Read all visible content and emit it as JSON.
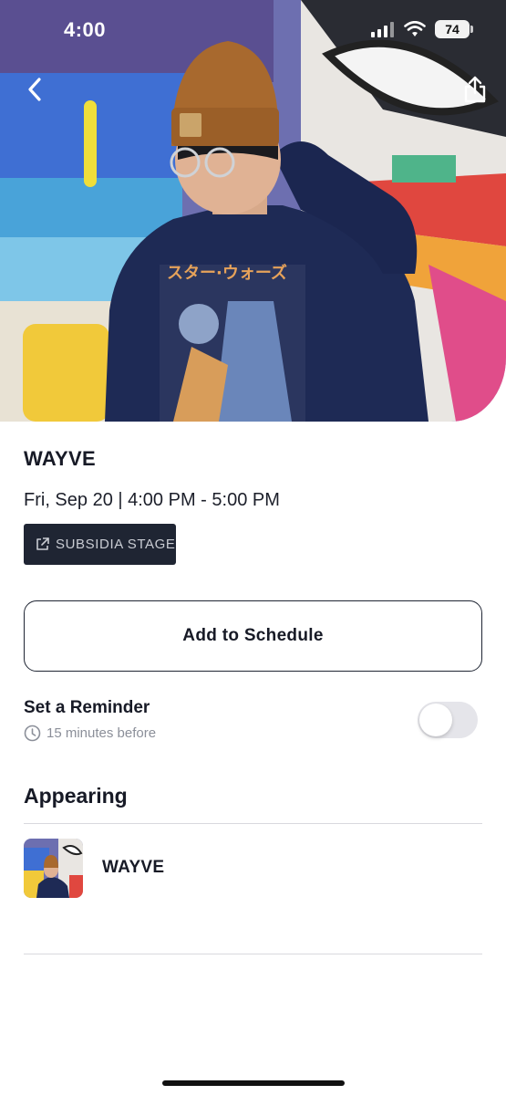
{
  "status_bar": {
    "time": "4:00",
    "battery": "74"
  },
  "hero": {
    "image_alt": "Performer wearing a brown beanie and navy sweatshirt in front of a colorful mural",
    "back_icon": "chevron-left-icon",
    "share_icon": "share-icon"
  },
  "event": {
    "artist": "WAYVE",
    "datetime": "Fri, Sep 20 | 4:00 PM - 5:00 PM",
    "stage": "SUBSIDIA STAGE",
    "stage_icon": "external-link-icon"
  },
  "actions": {
    "add_to_schedule": "Add to Schedule"
  },
  "reminder": {
    "title": "Set a Reminder",
    "subtitle": "15 minutes before",
    "enabled": false,
    "icon": "clock-icon"
  },
  "appearing": {
    "title": "Appearing",
    "performers": [
      {
        "name": "WAYVE"
      }
    ]
  },
  "colors": {
    "badge_bg": "#1f2533",
    "text_primary": "#171a26",
    "text_muted": "#8b8f99",
    "toggle_off": "#e5e5ea"
  }
}
